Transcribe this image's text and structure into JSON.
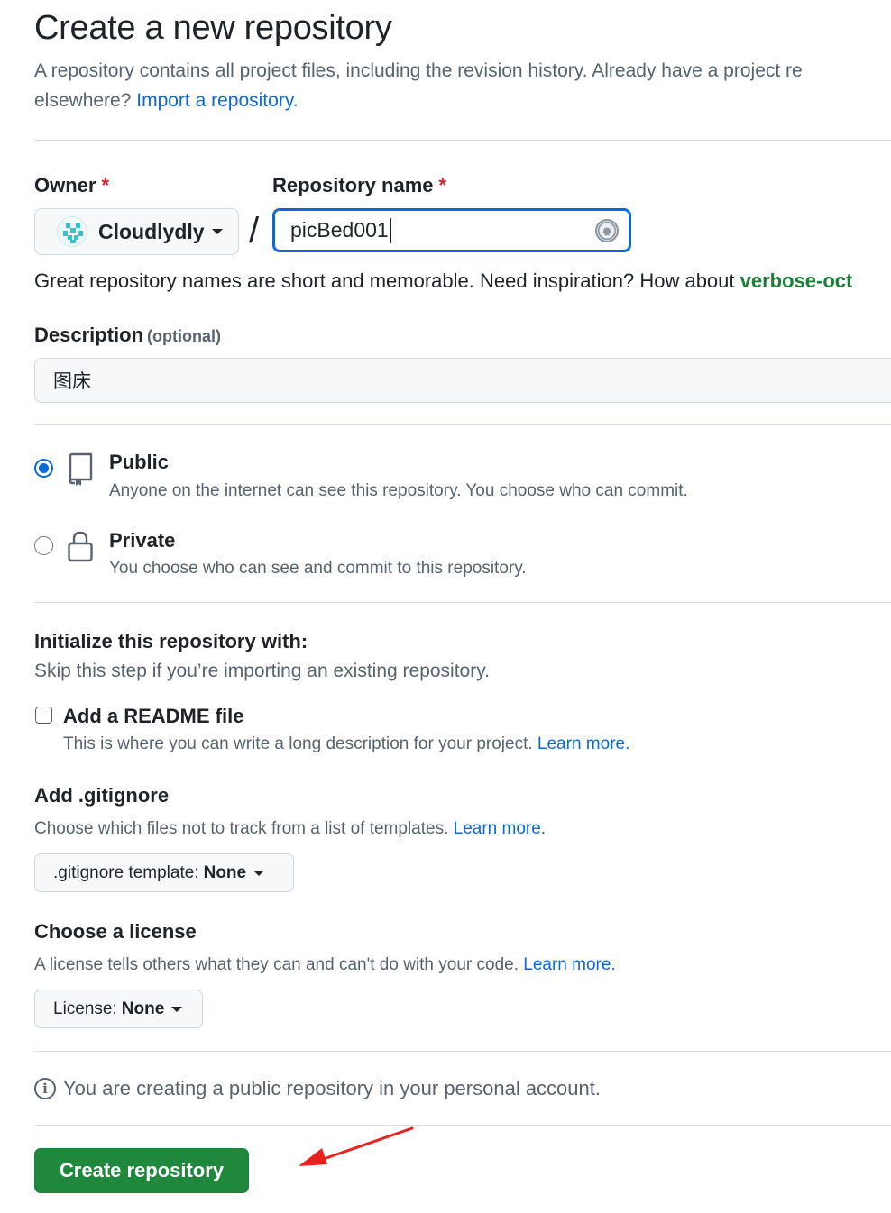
{
  "header": {
    "title": "Create a new repository",
    "subtitle_line1": "A repository contains all project files, including the revision history. Already have a project re",
    "subtitle_line2": "elsewhere?",
    "import_link": "Import a repository."
  },
  "owner": {
    "label": "Owner",
    "required_mark": "*",
    "value": "Cloudlydly"
  },
  "repo_name": {
    "label": "Repository name",
    "required_mark": "*",
    "value": "picBed001"
  },
  "slash": "/",
  "name_hint": {
    "text": "Great repository names are short and memorable. Need inspiration? How about",
    "suggestion": "verbose-oct"
  },
  "description": {
    "label": "Description",
    "optional": "(optional)",
    "value": "图床"
  },
  "visibility": {
    "selected": "Public",
    "options": [
      {
        "title": "Public",
        "desc": "Anyone on the internet can see this repository. You choose who can commit.",
        "icon": "repo-icon"
      },
      {
        "title": "Private",
        "desc": "You choose who can see and commit to this repository.",
        "icon": "lock-icon"
      }
    ]
  },
  "initialize": {
    "title": "Initialize this repository with:",
    "subtitle": "Skip this step if you’re importing an existing repository.",
    "readme": {
      "label": "Add a README file",
      "desc": "This is where you can write a long description for your project.",
      "link": "Learn more.",
      "checked": false
    }
  },
  "gitignore": {
    "title": "Add .gitignore",
    "desc": "Choose which files not to track from a list of templates.",
    "link": "Learn more.",
    "button_prefix": ".gitignore template:",
    "button_value": "None"
  },
  "license": {
    "title": "Choose a license",
    "desc": "A license tells others what they can and can't do with your code.",
    "link": "Learn more.",
    "button_prefix": "License:",
    "button_value": "None"
  },
  "info": {
    "icon": "info-icon",
    "text": "You are creating a public repository in your personal account."
  },
  "submit": {
    "label": "Create repository"
  },
  "colors": {
    "link": "#0969da",
    "primary_button": "#1f883d",
    "suggestion": "#1a7f37",
    "required": "#d1242f",
    "annotation_arrow": "#e8231f"
  }
}
